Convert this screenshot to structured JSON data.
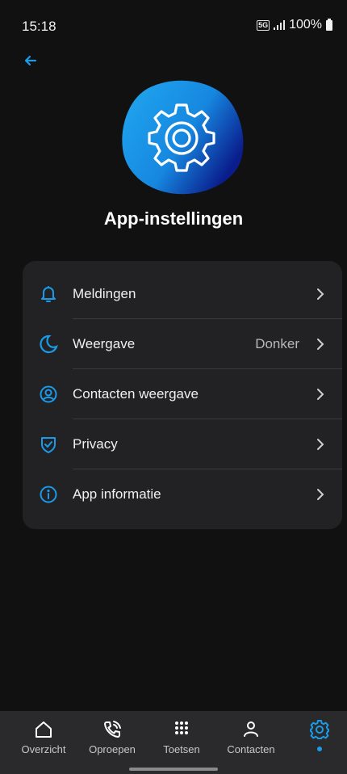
{
  "status_bar": {
    "time": "15:18",
    "network": "5G",
    "battery": "100%"
  },
  "header": {
    "back_icon": "arrow-left-icon",
    "hero_icon": "gear-icon",
    "title": "App-instellingen"
  },
  "settings": {
    "items": [
      {
        "label": "Meldingen",
        "value": "",
        "icon": "bell-icon"
      },
      {
        "label": "Weergave",
        "value": "Donker",
        "icon": "moon-icon"
      },
      {
        "label": "Contacten weergave",
        "value": "",
        "icon": "user-circle-icon"
      },
      {
        "label": "Privacy",
        "value": "",
        "icon": "shield-check-icon"
      },
      {
        "label": "App informatie",
        "value": "",
        "icon": "info-icon"
      }
    ]
  },
  "nav": {
    "items": [
      {
        "label": "Overzicht",
        "icon": "home-icon"
      },
      {
        "label": "Oproepen",
        "icon": "phone-icon"
      },
      {
        "label": "Toetsen",
        "icon": "dialpad-icon"
      },
      {
        "label": "Contacten",
        "icon": "person-icon"
      },
      {
        "label": "",
        "icon": "settings-icon",
        "active": true
      }
    ]
  },
  "colors": {
    "accent": "#1a9bea",
    "background": "#111111",
    "card": "#222224"
  }
}
